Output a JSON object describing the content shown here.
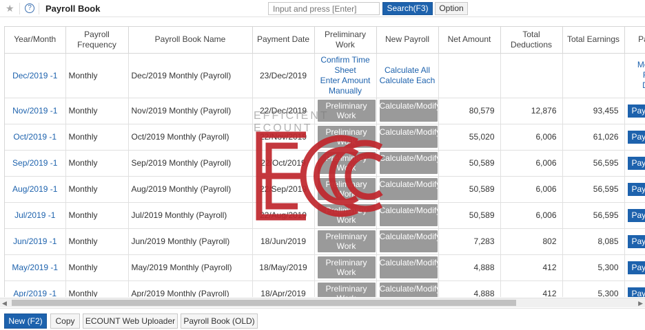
{
  "header": {
    "title": "Payroll Book",
    "search_placeholder": "Input and press [Enter]",
    "search_button": "Search(F3)",
    "option_button": "Option"
  },
  "table": {
    "columns": [
      "Year/Month",
      "Payroll Frequency",
      "Payroll Book Name",
      "Payment Date",
      "Preliminary Work",
      "New Payroll",
      "Net Amount",
      "Total Deductions",
      "Total Earnings",
      "Pay"
    ],
    "first_row": {
      "year_month": "Dec/2019 -1",
      "frequency": "Monthly",
      "name": "Dec/2019 Monthly (Payroll)",
      "payment_date": "23/Dec/2019",
      "prelim_links": [
        "Confirm Time Sheet",
        "Enter Amount Manually"
      ],
      "new_payroll_links": [
        "Calculate All",
        "Calculate Each"
      ],
      "extra_links": [
        "Mod",
        "F",
        "D"
      ]
    },
    "rows": [
      {
        "year_month": "Nov/2019 -1",
        "frequency": "Monthly",
        "name": "Nov/2019 Monthly (Payroll)",
        "payment_date": "22/Dec/2019",
        "prelim": "Preliminary Work",
        "calc": "Calculate/Modify",
        "net": "80,579",
        "deductions": "12,876",
        "earnings": "93,455",
        "pay": "Pay"
      },
      {
        "year_month": "Oct/2019 -1",
        "frequency": "Monthly",
        "name": "Oct/2019 Monthly (Payroll)",
        "payment_date": "22/Nov/2019",
        "prelim": "Preliminary Work",
        "calc": "Calculate/Modify",
        "net": "55,020",
        "deductions": "6,006",
        "earnings": "61,026",
        "pay": "Pay"
      },
      {
        "year_month": "Sep/2019 -1",
        "frequency": "Monthly",
        "name": "Sep/2019 Monthly (Payroll)",
        "payment_date": "22/Oct/2019",
        "prelim": "Preliminary Work",
        "calc": "Calculate/Modify",
        "net": "50,589",
        "deductions": "6,006",
        "earnings": "56,595",
        "pay": "Pay"
      },
      {
        "year_month": "Aug/2019 -1",
        "frequency": "Monthly",
        "name": "Aug/2019 Monthly (Payroll)",
        "payment_date": "22/Sep/2019",
        "prelim": "Preliminary Work",
        "calc": "Calculate/Modify",
        "net": "50,589",
        "deductions": "6,006",
        "earnings": "56,595",
        "pay": "Pay"
      },
      {
        "year_month": "Jul/2019 -1",
        "frequency": "Monthly",
        "name": "Jul/2019 Monthly (Payroll)",
        "payment_date": "22/Aug/2019",
        "prelim": "Preliminary Work",
        "calc": "Calculate/Modify",
        "net": "50,589",
        "deductions": "6,006",
        "earnings": "56,595",
        "pay": "Pay"
      },
      {
        "year_month": "Jun/2019 -1",
        "frequency": "Monthly",
        "name": "Jun/2019 Monthly (Payroll)",
        "payment_date": "18/Jun/2019",
        "prelim": "Preliminary Work",
        "calc": "Calculate/Modify",
        "net": "7,283",
        "deductions": "802",
        "earnings": "8,085",
        "pay": "Pay"
      },
      {
        "year_month": "May/2019 -1",
        "frequency": "Monthly",
        "name": "May/2019 Monthly (Payroll)",
        "payment_date": "18/May/2019",
        "prelim": "Preliminary Work",
        "calc": "Calculate/Modify",
        "net": "4,888",
        "deductions": "412",
        "earnings": "5,300",
        "pay": "Pay"
      },
      {
        "year_month": "Apr/2019 -1",
        "frequency": "Monthly",
        "name": "Apr/2019 Monthly (Payroll)",
        "payment_date": "18/Apr/2019",
        "prelim": "Preliminary Work",
        "calc": "Calculate/Modify",
        "net": "4,888",
        "deductions": "412",
        "earnings": "5,300",
        "pay": "Pay"
      }
    ]
  },
  "watermark": {
    "text": "EFFICIENT ECOUNT",
    "logo": "ECOUNT logo"
  },
  "footer": {
    "new_button": "New (F2)",
    "copy_button": "Copy",
    "uploader_button": "ECOUNT Web Uploader",
    "old_button": "Payroll Book (OLD)"
  },
  "colors": {
    "accent": "#1d62ad",
    "button_gray": "#9a9a9a",
    "logo_red": "#c0272d"
  }
}
